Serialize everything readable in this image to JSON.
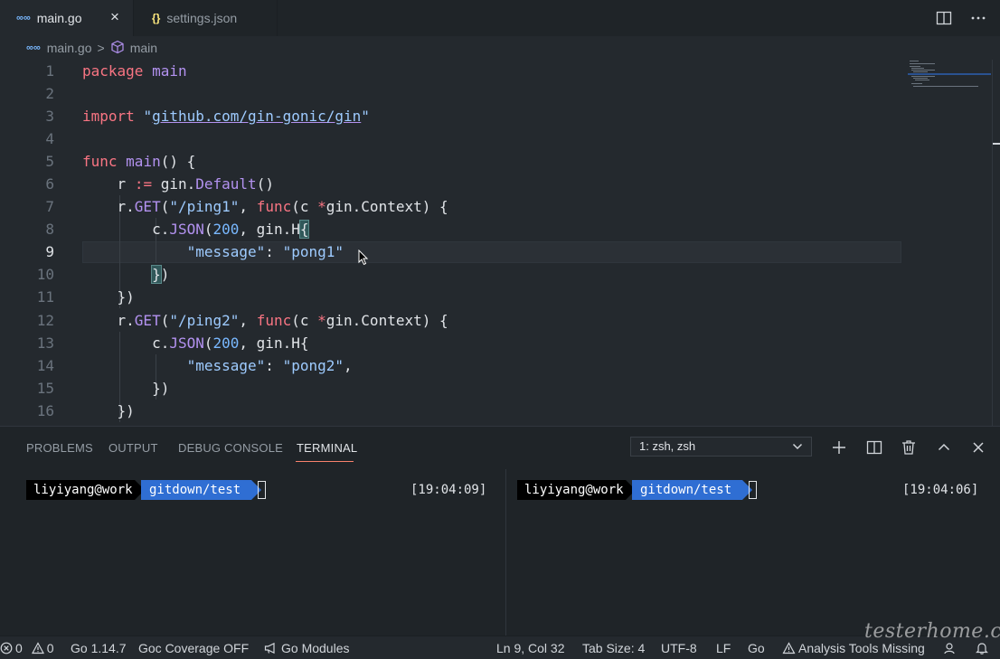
{
  "tabs": [
    {
      "icon": "∞∞",
      "label": "main.go",
      "close": "×"
    },
    {
      "icon": "{}",
      "label": "settings.json"
    }
  ],
  "breadcrumb": {
    "icon": "∞∞",
    "file": "main.go",
    "sep": ">",
    "symbol": "main"
  },
  "editor": {
    "line_numbers": [
      "1",
      "2",
      "3",
      "4",
      "5",
      "6",
      "7",
      "8",
      "9",
      "10",
      "11",
      "12",
      "13",
      "14",
      "15",
      "16"
    ],
    "tokens": {
      "package": "package",
      "main": "main",
      "import": "import",
      "quote": "\"",
      "gin_path": "github.com/gin-gonic/gin",
      "func": "func",
      "main_fn": "main",
      "func_open": "() {",
      "r": "r",
      "assign": ":=",
      "gin_dot": "gin.",
      "default": "Default",
      "parens": "()",
      "r_dot": "r.",
      "get": "GET",
      "paren_open": "(",
      "ping1": "\"/ping1\"",
      "ping2": "\"/ping2\"",
      "comma": ",",
      "c": "(c",
      "star": "*",
      "gin_context": "gin.Context) {",
      "c_dot": "c.",
      "json": "JSON",
      "two_hundred": "200",
      "gin_h": ", gin.H",
      "brace_open": "{",
      "message": "\"message\"",
      "colon": ":",
      "pong1": "\"pong1\"",
      "pong2": "\"pong2\"",
      "brace_close": "}",
      "paren_close": ")",
      "close_brace_paren": "})"
    }
  },
  "panel": {
    "tabs": [
      "PROBLEMS",
      "OUTPUT",
      "DEBUG CONSOLE",
      "TERMINAL"
    ],
    "terminal_select": "1: zsh, zsh",
    "terminals": [
      {
        "user": "liyiyang@work",
        "branch": "gitdown/test",
        "time": "[19:04:09]"
      },
      {
        "user": "liyiyang@work",
        "branch": "gitdown/test",
        "time": "[19:04:06]"
      }
    ]
  },
  "statusbar": {
    "errors": "0",
    "warnings": "0",
    "go_version": "Go 1.14.7",
    "coverage": "Goc Coverage OFF",
    "modules": "Go Modules",
    "position": "Ln 9, Col 32",
    "tab_size": "Tab Size: 4",
    "encoding": "UTF-8",
    "eol": "LF",
    "language": "Go",
    "analysis": "Analysis Tools Missing"
  },
  "watermark": "testerhome.com",
  "colors": {
    "editor_bg": "#24292e",
    "tab_bar_bg": "#1f2428",
    "keyword": "#f97583",
    "function": "#b392f0",
    "string": "#9ecbff",
    "accent": "#f9826c",
    "git_segment": "#2f6ed3"
  }
}
